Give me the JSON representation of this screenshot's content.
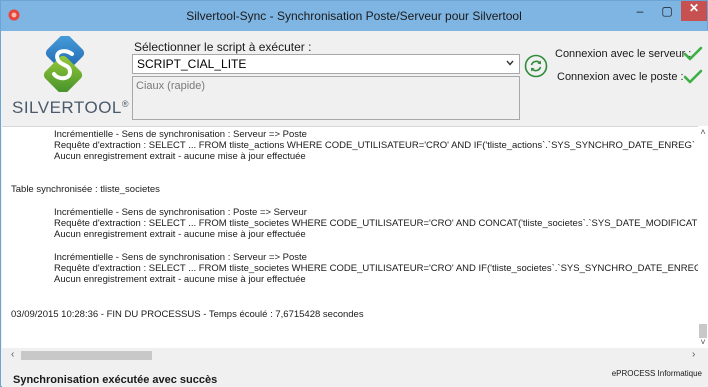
{
  "window": {
    "title": "Silvertool-Sync - Synchronisation Poste/Serveur pour Silvertool",
    "minimize_label": "–",
    "maximize_label": "▢",
    "close_label": "✕"
  },
  "colors": {
    "titlebar": "#7fb5e3",
    "close_button": "#c75050",
    "check_green": "#3cb043",
    "sync_icon_green": "#2e8b3a"
  },
  "logo": {
    "text": "SILVERTOOL",
    "mark": "®"
  },
  "script": {
    "label": "Sélectionner le script à exécuter :",
    "selected": "SCRIPT_CIAL_LITE",
    "description": "Ciaux (rapide)"
  },
  "connection": {
    "server_label": "Connexion avec le serveur :",
    "post_label": "Connexion avec le poste :",
    "server_ok": "check-icon",
    "post_ok": "check-icon"
  },
  "log": {
    "lines": [
      "Incrémentielle - Sens de synchronisation : Serveur => Poste",
      "Requête d'extraction : SELECT ... FROM tliste_actions WHERE CODE_UTILISATEUR='CRO' AND  IF('tliste_actions`.`SYS_SYNCHRO_DATE_ENREG` IS",
      "Aucun enregistrement extrait - aucune mise à jour effectuée",
      "Table synchronisée : tliste_societes",
      "Incrémentielle - Sens de synchronisation : Poste => Serveur",
      "Requête d'extraction : SELECT ... FROM tliste_societes WHERE CODE_UTILISATEUR='CRO' AND  CONCAT('tliste_societes`.`SYS_DATE_MODIFICATIC",
      "Aucun enregistrement extrait - aucune mise à jour effectuée",
      "Incrémentielle - Sens de synchronisation : Serveur => Poste",
      "Requête d'extraction : SELECT ... FROM tliste_societes WHERE CODE_UTILISATEUR='CRO' AND  IF('tliste_societes`.`SYS_SYNCHRO_DATE_ENREG`",
      "Aucun enregistrement extrait - aucune mise à jour effectuée",
      "03/09/2015 10:28:36 - FIN DU PROCESSUS - Temps écoulé : 7,6715428 secondes"
    ]
  },
  "status": {
    "message": "Synchronisation exécutée avec succès",
    "company": "ePROCESS Informatique"
  }
}
